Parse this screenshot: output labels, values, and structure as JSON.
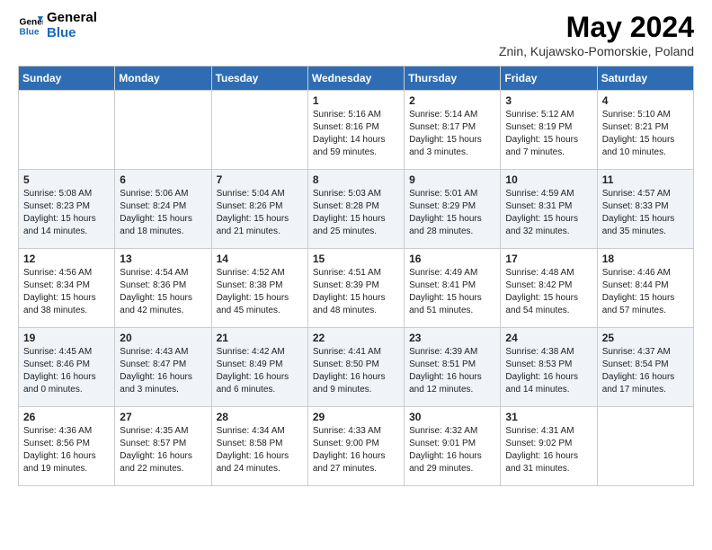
{
  "header": {
    "logo_line1": "General",
    "logo_line2": "Blue",
    "month_year": "May 2024",
    "location": "Znin, Kujawsko-Pomorskie, Poland"
  },
  "weekdays": [
    "Sunday",
    "Monday",
    "Tuesday",
    "Wednesday",
    "Thursday",
    "Friday",
    "Saturday"
  ],
  "weeks": [
    [
      {
        "day": "",
        "info": ""
      },
      {
        "day": "",
        "info": ""
      },
      {
        "day": "",
        "info": ""
      },
      {
        "day": "1",
        "info": "Sunrise: 5:16 AM\nSunset: 8:16 PM\nDaylight: 14 hours\nand 59 minutes."
      },
      {
        "day": "2",
        "info": "Sunrise: 5:14 AM\nSunset: 8:17 PM\nDaylight: 15 hours\nand 3 minutes."
      },
      {
        "day": "3",
        "info": "Sunrise: 5:12 AM\nSunset: 8:19 PM\nDaylight: 15 hours\nand 7 minutes."
      },
      {
        "day": "4",
        "info": "Sunrise: 5:10 AM\nSunset: 8:21 PM\nDaylight: 15 hours\nand 10 minutes."
      }
    ],
    [
      {
        "day": "5",
        "info": "Sunrise: 5:08 AM\nSunset: 8:23 PM\nDaylight: 15 hours\nand 14 minutes."
      },
      {
        "day": "6",
        "info": "Sunrise: 5:06 AM\nSunset: 8:24 PM\nDaylight: 15 hours\nand 18 minutes."
      },
      {
        "day": "7",
        "info": "Sunrise: 5:04 AM\nSunset: 8:26 PM\nDaylight: 15 hours\nand 21 minutes."
      },
      {
        "day": "8",
        "info": "Sunrise: 5:03 AM\nSunset: 8:28 PM\nDaylight: 15 hours\nand 25 minutes."
      },
      {
        "day": "9",
        "info": "Sunrise: 5:01 AM\nSunset: 8:29 PM\nDaylight: 15 hours\nand 28 minutes."
      },
      {
        "day": "10",
        "info": "Sunrise: 4:59 AM\nSunset: 8:31 PM\nDaylight: 15 hours\nand 32 minutes."
      },
      {
        "day": "11",
        "info": "Sunrise: 4:57 AM\nSunset: 8:33 PM\nDaylight: 15 hours\nand 35 minutes."
      }
    ],
    [
      {
        "day": "12",
        "info": "Sunrise: 4:56 AM\nSunset: 8:34 PM\nDaylight: 15 hours\nand 38 minutes."
      },
      {
        "day": "13",
        "info": "Sunrise: 4:54 AM\nSunset: 8:36 PM\nDaylight: 15 hours\nand 42 minutes."
      },
      {
        "day": "14",
        "info": "Sunrise: 4:52 AM\nSunset: 8:38 PM\nDaylight: 15 hours\nand 45 minutes."
      },
      {
        "day": "15",
        "info": "Sunrise: 4:51 AM\nSunset: 8:39 PM\nDaylight: 15 hours\nand 48 minutes."
      },
      {
        "day": "16",
        "info": "Sunrise: 4:49 AM\nSunset: 8:41 PM\nDaylight: 15 hours\nand 51 minutes."
      },
      {
        "day": "17",
        "info": "Sunrise: 4:48 AM\nSunset: 8:42 PM\nDaylight: 15 hours\nand 54 minutes."
      },
      {
        "day": "18",
        "info": "Sunrise: 4:46 AM\nSunset: 8:44 PM\nDaylight: 15 hours\nand 57 minutes."
      }
    ],
    [
      {
        "day": "19",
        "info": "Sunrise: 4:45 AM\nSunset: 8:46 PM\nDaylight: 16 hours\nand 0 minutes."
      },
      {
        "day": "20",
        "info": "Sunrise: 4:43 AM\nSunset: 8:47 PM\nDaylight: 16 hours\nand 3 minutes."
      },
      {
        "day": "21",
        "info": "Sunrise: 4:42 AM\nSunset: 8:49 PM\nDaylight: 16 hours\nand 6 minutes."
      },
      {
        "day": "22",
        "info": "Sunrise: 4:41 AM\nSunset: 8:50 PM\nDaylight: 16 hours\nand 9 minutes."
      },
      {
        "day": "23",
        "info": "Sunrise: 4:39 AM\nSunset: 8:51 PM\nDaylight: 16 hours\nand 12 minutes."
      },
      {
        "day": "24",
        "info": "Sunrise: 4:38 AM\nSunset: 8:53 PM\nDaylight: 16 hours\nand 14 minutes."
      },
      {
        "day": "25",
        "info": "Sunrise: 4:37 AM\nSunset: 8:54 PM\nDaylight: 16 hours\nand 17 minutes."
      }
    ],
    [
      {
        "day": "26",
        "info": "Sunrise: 4:36 AM\nSunset: 8:56 PM\nDaylight: 16 hours\nand 19 minutes."
      },
      {
        "day": "27",
        "info": "Sunrise: 4:35 AM\nSunset: 8:57 PM\nDaylight: 16 hours\nand 22 minutes."
      },
      {
        "day": "28",
        "info": "Sunrise: 4:34 AM\nSunset: 8:58 PM\nDaylight: 16 hours\nand 24 minutes."
      },
      {
        "day": "29",
        "info": "Sunrise: 4:33 AM\nSunset: 9:00 PM\nDaylight: 16 hours\nand 27 minutes."
      },
      {
        "day": "30",
        "info": "Sunrise: 4:32 AM\nSunset: 9:01 PM\nDaylight: 16 hours\nand 29 minutes."
      },
      {
        "day": "31",
        "info": "Sunrise: 4:31 AM\nSunset: 9:02 PM\nDaylight: 16 hours\nand 31 minutes."
      },
      {
        "day": "",
        "info": ""
      }
    ]
  ]
}
